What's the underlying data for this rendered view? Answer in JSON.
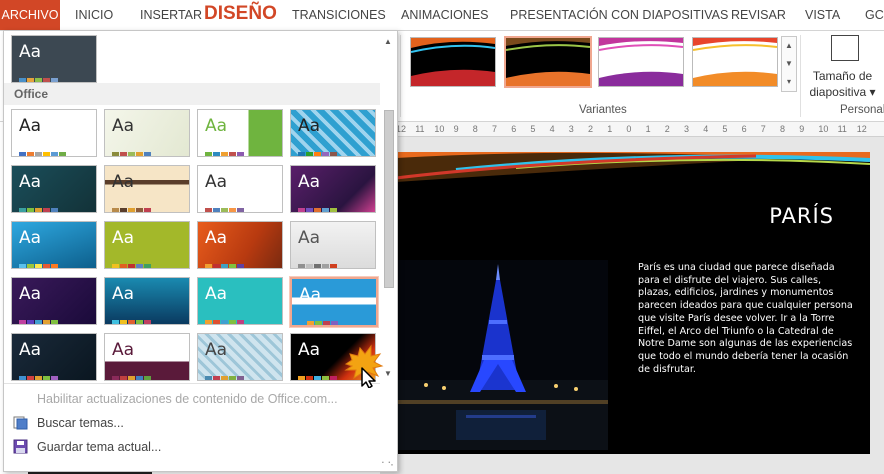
{
  "tabs": {
    "archivo": "ARCHIVO",
    "inicio": "INICIO",
    "insertar": "INSERTAR",
    "diseno": "DISEÑO",
    "transiciones": "TRANSICIONES",
    "animaciones": "ANIMACIONES",
    "presentacion": "PRESENTACIÓN CON DIAPOSITIVAS",
    "revisar": "REVISAR",
    "vista": "VISTA",
    "overflow": "GCI"
  },
  "ribbon": {
    "variants_label": "Variantes",
    "slide_size_line1": "Tamaño de",
    "slide_size_line2": "diapositiva ▾",
    "personal_label": "Personal",
    "selected_variant": 1
  },
  "gallery": {
    "section_office": "Office",
    "selected_theme_index": 15,
    "theme_label": "Aa",
    "update_content": "Habilitar actualizaciones de contenido de Office.com...",
    "browse_themes": "Buscar temas...",
    "save_theme": "Guardar tema actual..."
  },
  "ruler": {
    "ticks": [
      "12",
      "11",
      "10",
      "9",
      "8",
      "7",
      "6",
      "5",
      "4",
      "3",
      "2",
      "1",
      "0",
      "1",
      "2",
      "3",
      "4",
      "5",
      "6",
      "7",
      "8",
      "9",
      "10",
      "11",
      "12"
    ]
  },
  "slide": {
    "title": "PARÍS",
    "body": "París es una ciudad que parece diseñada para el disfrute del viajero. Sus calles, plazas, edificios, jardines y monumentos parecen ideados para que cualquier persona que visite París desee volver. Ir a la Torre Eiffel, el Arco del Triunfo o la Catedral de Notre Dame son algunas de las experiencias que todo el mundo debería tener la ocasión de disfrutar."
  },
  "colors": {
    "accent": "#d24726",
    "selection_border": "#f0a78f"
  }
}
